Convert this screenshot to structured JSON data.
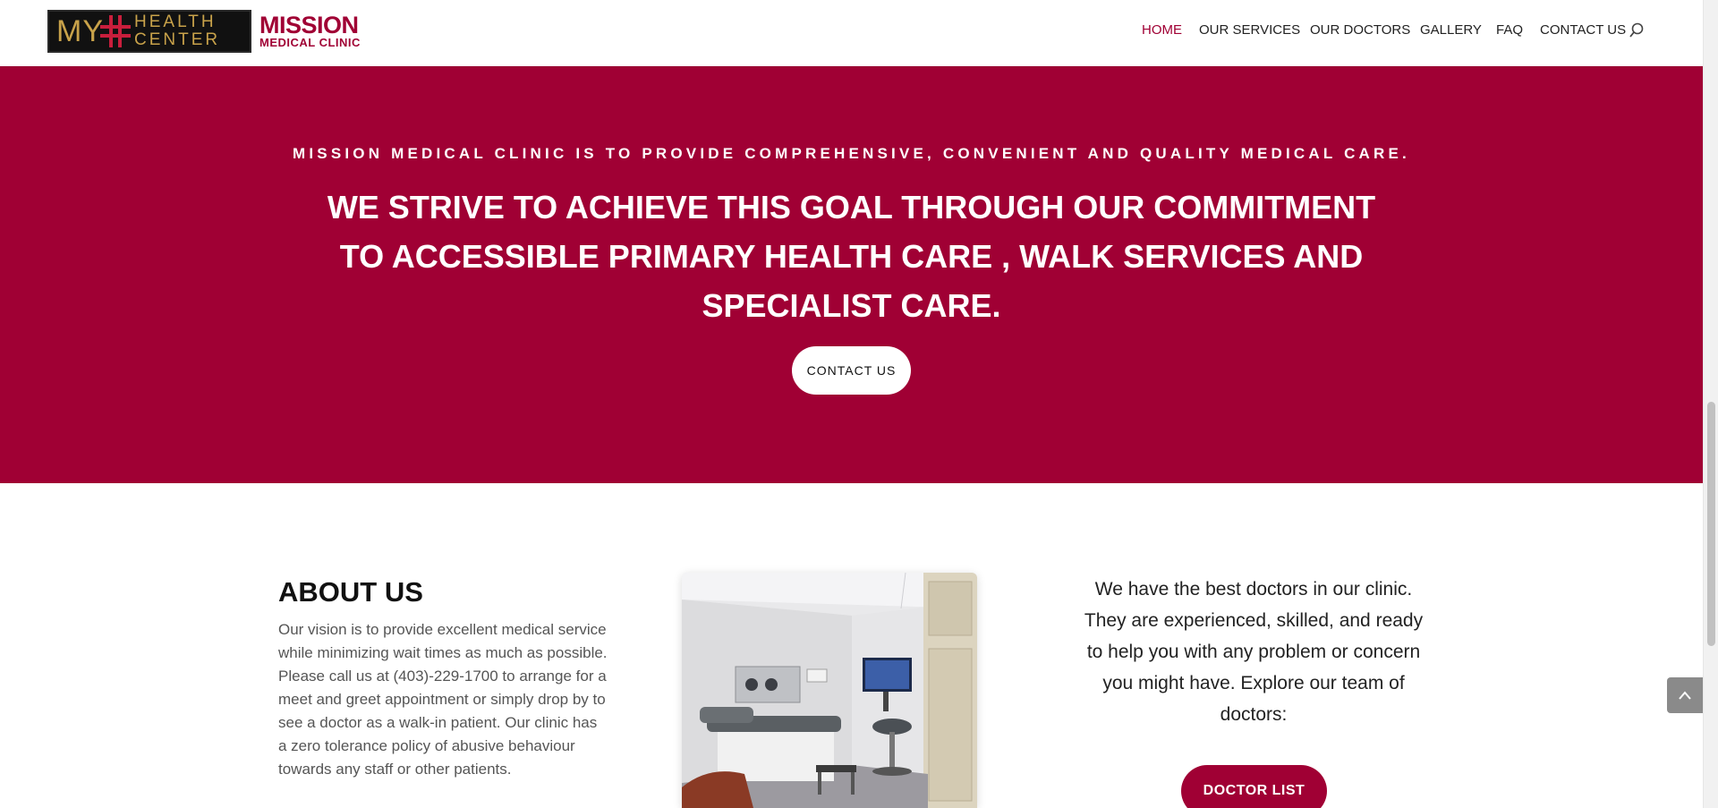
{
  "logo": {
    "my": "MY",
    "health": "HEALTH",
    "center": "CENTER",
    "mission": "MISSION",
    "medical_clinic": "MEDICAL CLINIC"
  },
  "nav": {
    "items": [
      {
        "label": "HOME",
        "active": true
      },
      {
        "label": "OUR SERVICES",
        "active": false
      },
      {
        "label": "OUR DOCTORS",
        "active": false
      },
      {
        "label": "GALLERY",
        "active": false
      },
      {
        "label": "FAQ",
        "active": false
      },
      {
        "label": "CONTACT US",
        "active": false
      }
    ],
    "search_icon": "search-icon"
  },
  "hero": {
    "subtitle": "MISSION MEDICAL CLINIC IS TO PROVIDE COMPREHENSIVE, CONVENIENT AND QUALITY MEDICAL CARE.",
    "title": "WE STRIVE TO ACHIEVE THIS GOAL THROUGH OUR COMMITMENT TO ACCESSIBLE PRIMARY HEALTH CARE , WALK SERVICES AND SPECIALIST CARE.",
    "button_label": "CONTACT US"
  },
  "about": {
    "title": "ABOUT US",
    "text": "Our vision is to provide excellent medical service while minimizing wait times as much as possible. Please call us at (403)-229-1700 to arrange for a meet and greet appointment or simply drop by to see a doctor as a walk-in patient. Our clinic has a zero tolerance policy of abusive behaviour towards any staff or other patients."
  },
  "doctors": {
    "text": "We have the best doctors in our clinic. They are experienced, skilled, and ready to help you with any problem or concern you might have. Explore our team of doctors:",
    "button_label": "DOCTOR LIST"
  },
  "colors": {
    "brand": "#a00034",
    "gold": "#c8a24a",
    "text_dark": "#222222",
    "text_body": "#555555"
  },
  "icons": {
    "scroll_top": "chevron-up-icon"
  }
}
